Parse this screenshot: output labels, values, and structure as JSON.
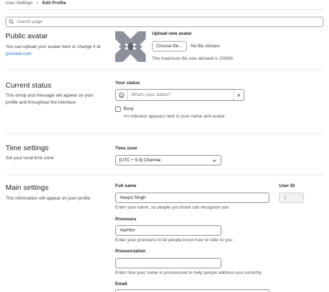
{
  "breadcrumb": {
    "parent": "User Settings",
    "separator": ">",
    "current": "Edit Profile"
  },
  "search": {
    "placeholder": "Search page"
  },
  "public_avatar": {
    "title": "Public avatar",
    "desc_prefix": "You can upload your avatar here or change it at",
    "desc_link": "gravatar.com",
    "upload_label": "Upload new avatar",
    "choose_button": "Choose file...",
    "file_status": "No file chosen.",
    "max_size_note": "The maximum file size allowed is 200KB."
  },
  "current_status": {
    "title": "Current status",
    "desc": "This emoji and message will appear on your profile and throughout the interface.",
    "label": "Your status",
    "placeholder": "What's your status?",
    "clear_glyph": "×",
    "busy_label": "Busy",
    "busy_checked": false,
    "busy_help": "An indicator appears next to your name and avatar"
  },
  "time_settings": {
    "title": "Time settings",
    "desc": "Set your local time zone",
    "label": "Time zone",
    "value": "[UTC + 5.5] Chennai"
  },
  "main_settings": {
    "title": "Main settings",
    "desc": "This information will appear on your profile",
    "full_name_label": "Full name",
    "full_name_value": "Navjot Singh",
    "full_name_help": "Enter your name, so people you know can recognize you",
    "user_id_label": "User ID",
    "user_id_value": "1",
    "pronouns_label": "Pronouns",
    "pronouns_value": "He/Him",
    "pronouns_help": "Enter your pronouns to let people know how to refer to you",
    "pronunciation_label": "Pronunciation",
    "pronunciation_value": "",
    "pronunciation_help": "Enter how your name is pronounced to help people address you correctly",
    "email_label": "Email"
  },
  "icons": {
    "search": "search-icon",
    "emoji": "smiley-icon",
    "chevron": "chevron-down-icon",
    "avatar": "identicon-avatar"
  }
}
